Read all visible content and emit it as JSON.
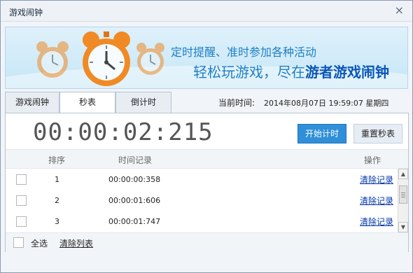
{
  "window": {
    "title": "游戏闹钟",
    "close_glyph": "×"
  },
  "banner": {
    "slogan_line1": "定时提醒、准时参加各种活动",
    "slogan_line2_prefix": "轻松玩游戏，尽在",
    "slogan_line2_brand": "游者游戏闹钟"
  },
  "tabs": [
    {
      "label": "游戏闹钟",
      "active": false
    },
    {
      "label": "秒表",
      "active": true
    },
    {
      "label": "倒计时",
      "active": false
    }
  ],
  "current_time": {
    "label": "当前时间:",
    "value": "2014年08月07日  19:59:07  星期四"
  },
  "stopwatch": {
    "display": "00:00:02:215",
    "start_label": "开始计时",
    "reset_label": "重置秒表"
  },
  "table": {
    "headers": {
      "index": "排序",
      "record": "时间记录",
      "action": "操作"
    },
    "rows": [
      {
        "index": "1",
        "time": "00:00:00:358",
        "action": "清除记录"
      },
      {
        "index": "2",
        "time": "00:00:01:606",
        "action": "清除记录"
      },
      {
        "index": "3",
        "time": "00:00:01:747",
        "action": "清除记录"
      }
    ]
  },
  "footer": {
    "select_all": "全选",
    "clear_list": "清除列表"
  },
  "colors": {
    "accent_blue": "#2f8fd8",
    "link_blue": "#0033aa",
    "clock_orange": "#f08a24"
  },
  "icons": {
    "close": "close-icon",
    "alarm_clock": "alarm-clock-icon",
    "scroll_up": "scroll-up-icon",
    "scroll_down": "scroll-down-icon"
  }
}
